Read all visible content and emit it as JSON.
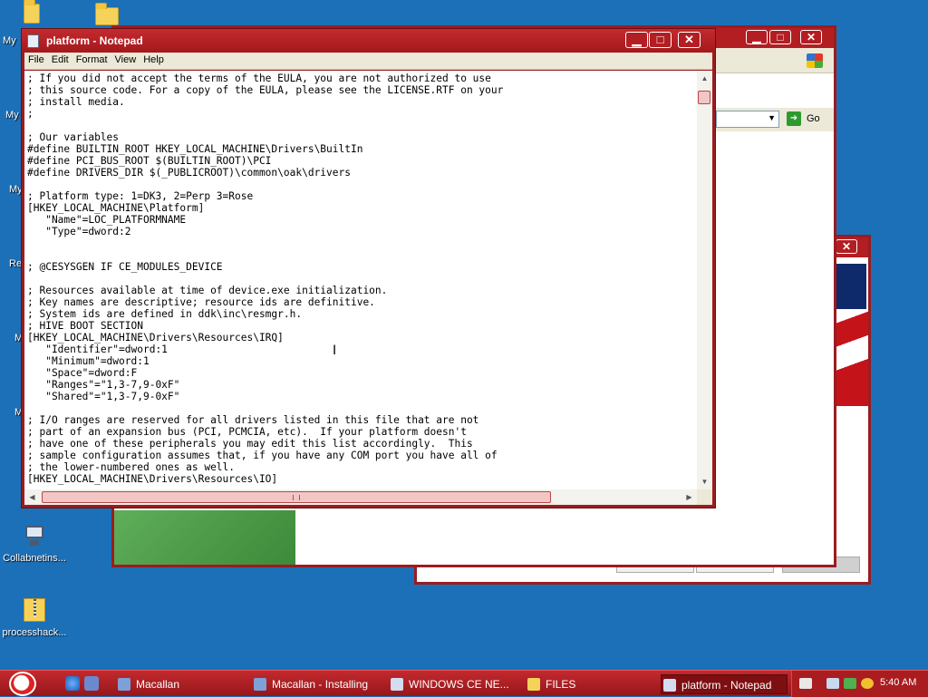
{
  "desktop": {
    "icons": [
      {
        "label": "Collabnetins..."
      },
      {
        "label": "processhack..."
      }
    ],
    "edge_labels": [
      "My",
      "My",
      "My",
      "Re",
      "M",
      "M"
    ]
  },
  "background_windows": {
    "ie_window": {
      "go_label": "Go"
    }
  },
  "notepad": {
    "title": "platform - Notepad",
    "buttons": {
      "minimize": "▁",
      "maximize": "□",
      "close": "✕"
    },
    "menu": [
      "File",
      "Edit",
      "Format",
      "View",
      "Help"
    ],
    "lines": [
      "; If you did not accept the terms of the EULA, you are not authorized to use",
      "; this source code. For a copy of the EULA, please see the LICENSE.RTF on your",
      "; install media.",
      ";",
      "",
      "; Our variables",
      "#define BUILTIN_ROOT HKEY_LOCAL_MACHINE\\Drivers\\BuiltIn",
      "#define PCI_BUS_ROOT $(BUILTIN_ROOT)\\PCI",
      "#define DRIVERS_DIR $(_PUBLICROOT)\\common\\oak\\drivers",
      "",
      "; Platform type: 1=DK3, 2=Perp 3=Rose",
      "[HKEY_LOCAL_MACHINE\\Platform]",
      "   \"Name\"=LOC_PLATFORMNAME",
      "   \"Type\"=dword:2",
      "",
      "",
      "; @CESYSGEN IF CE_MODULES_DEVICE",
      "",
      "; Resources available at time of device.exe initialization.",
      "; Key names are descriptive; resource ids are definitive.",
      "; System ids are defined in ddk\\inc\\resmgr.h.",
      "; HIVE BOOT SECTION",
      "[HKEY_LOCAL_MACHINE\\Drivers\\Resources\\IRQ]",
      "   \"Identifier\"=dword:1",
      "   \"Minimum\"=dword:1",
      "   \"Space\"=dword:F",
      "   \"Ranges\"=\"1,3-7,9-0xF\"",
      "   \"Shared\"=\"1,3-7,9-0xF\"",
      "",
      "; I/O ranges are reserved for all drivers listed in this file that are not",
      "; part of an expansion bus (PCI, PCMCIA, etc).  If your platform doesn't",
      "; have one of these peripherals you may edit this list accordingly.  This",
      "; sample configuration assumes that, if you have any COM port you have all of",
      "; the lower-numbered ones as well.",
      "[HKEY_LOCAL_MACHINE\\Drivers\\Resources\\IO]"
    ]
  },
  "taskbar": {
    "items": [
      {
        "label": "Macallan",
        "active": false
      },
      {
        "label": "Macallan - Installing",
        "active": false
      },
      {
        "label": "WINDOWS CE NE...",
        "active": false
      },
      {
        "label": "FILES",
        "active": false
      },
      {
        "label": "platform - Notepad",
        "active": true
      }
    ],
    "clock": "5:40 AM"
  },
  "colors": {
    "titlebar": "#b21e22",
    "desktop": "#1c70b8",
    "taskbar": "#a91c20"
  }
}
